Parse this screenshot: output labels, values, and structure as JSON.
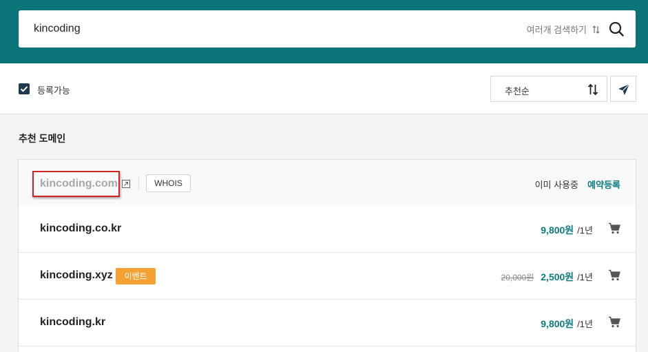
{
  "search": {
    "value": "kincoding",
    "multi_search_label": "여러개 검색하기"
  },
  "filter": {
    "checkbox_label": "등록가능",
    "checkbox_checked": true,
    "sort_label": "추천순"
  },
  "section": {
    "title": "추천 도메인"
  },
  "domains": [
    {
      "name": "kincoding.com",
      "status": "이미 사용중",
      "action": "예약등록",
      "whois": "WHOIS"
    },
    {
      "name": "kincoding.co.kr",
      "price": "9,800원",
      "period": "/1년"
    },
    {
      "name": "kincoding.xyz",
      "badge": "이벤트",
      "old_price": "20,000원",
      "price": "2,500원",
      "period": "/1년"
    },
    {
      "name": "kincoding.kr",
      "price": "9,800원",
      "period": "/1년"
    }
  ],
  "colors": {
    "header": "#0b7478",
    "accent": "#0b7c80",
    "badge": "#f7a135",
    "highlight_border": "#d32222"
  },
  "icons": [
    "search-icon",
    "sort-arrows-icon",
    "send-icon",
    "external-link-icon",
    "cart-icon",
    "check-icon"
  ]
}
